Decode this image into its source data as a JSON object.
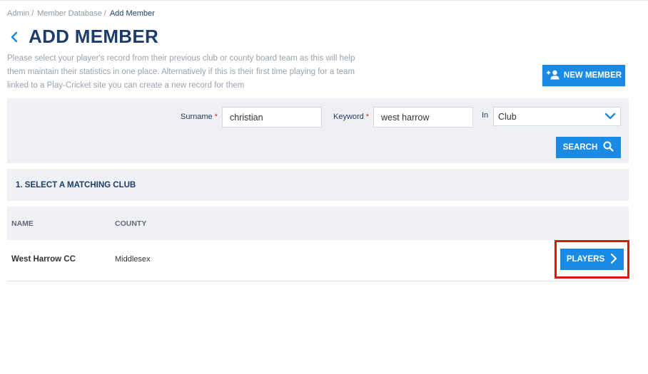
{
  "breadcrumb": {
    "items": [
      "Admin",
      "Member Database",
      "Add Member"
    ],
    "separator": "/"
  },
  "page": {
    "title": "ADD MEMBER",
    "intro": "Please select your player's record from their previous club or county board team as this will help them maintain their statistics in one place. Alternatively if this is their first time playing for a team linked to a Play-Cricket site you can create a new record for them"
  },
  "new_member_button": {
    "label": "NEW MEMBER",
    "icon": "add-person-icon"
  },
  "search": {
    "surname_label": "Surname",
    "surname_value": "christian",
    "keyword_label": "Keyword",
    "keyword_value": "west harrow",
    "required_mark": "*",
    "in_label": "In",
    "in_selected": "Club",
    "search_label": "SEARCH"
  },
  "section": {
    "title": "1. SELECT A MATCHING CLUB"
  },
  "table": {
    "columns": [
      "NAME",
      "COUNTY"
    ],
    "rows": [
      {
        "name": "West Harrow CC",
        "county": "Middlesex",
        "action": "PLAYERS"
      }
    ]
  },
  "colors": {
    "primary": "#1a8ae5",
    "title": "#1c3c6a",
    "panel": "#eef0f4",
    "highlight": "#e0160e"
  }
}
